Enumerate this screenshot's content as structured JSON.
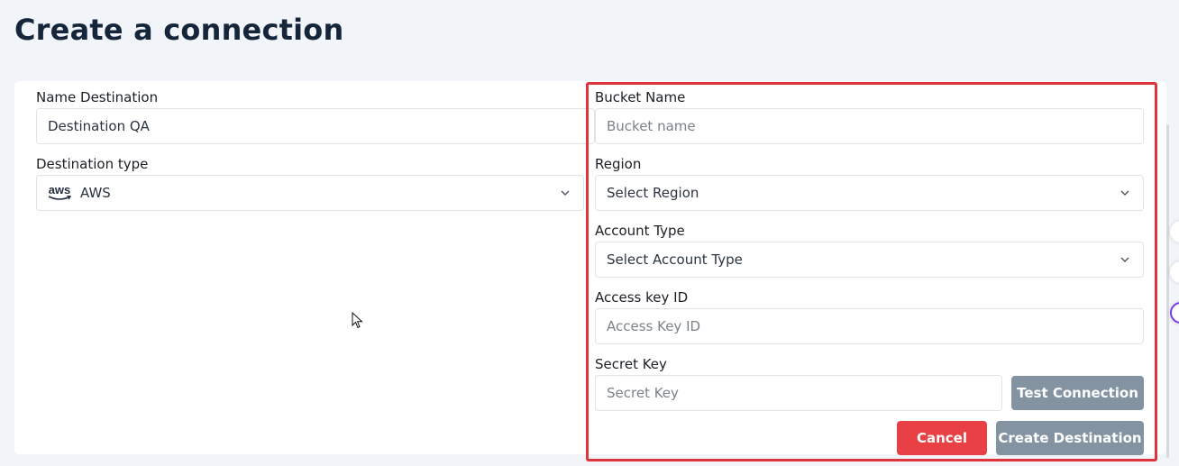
{
  "page": {
    "title": "Create a connection"
  },
  "left": {
    "name_label": "Name Destination",
    "name_value": "Destination QA",
    "type_label": "Destination type",
    "type_logo_text": "aws",
    "type_value": "AWS"
  },
  "right": {
    "bucket_label": "Bucket Name",
    "bucket_placeholder": "Bucket name",
    "region_label": "Region",
    "region_value": "Select Region",
    "account_label": "Account Type",
    "account_value": "Select Account Type",
    "access_label": "Access key ID",
    "access_placeholder": "Access Key ID",
    "secret_label": "Secret Key",
    "secret_placeholder": "Secret Key"
  },
  "buttons": {
    "test_connection": "Test Connection",
    "cancel": "Cancel",
    "create_destination": "Create Destination"
  },
  "colors": {
    "highlight_border": "#e0343c",
    "cancel_button": "#e94045",
    "disabled_button": "#8393a1",
    "page_background": "#f1f4f9"
  },
  "icons": {
    "select_arrow": "chevron-down-icon",
    "aws_logo": "aws-logo-icon",
    "cursor": "mouse-cursor-icon"
  }
}
